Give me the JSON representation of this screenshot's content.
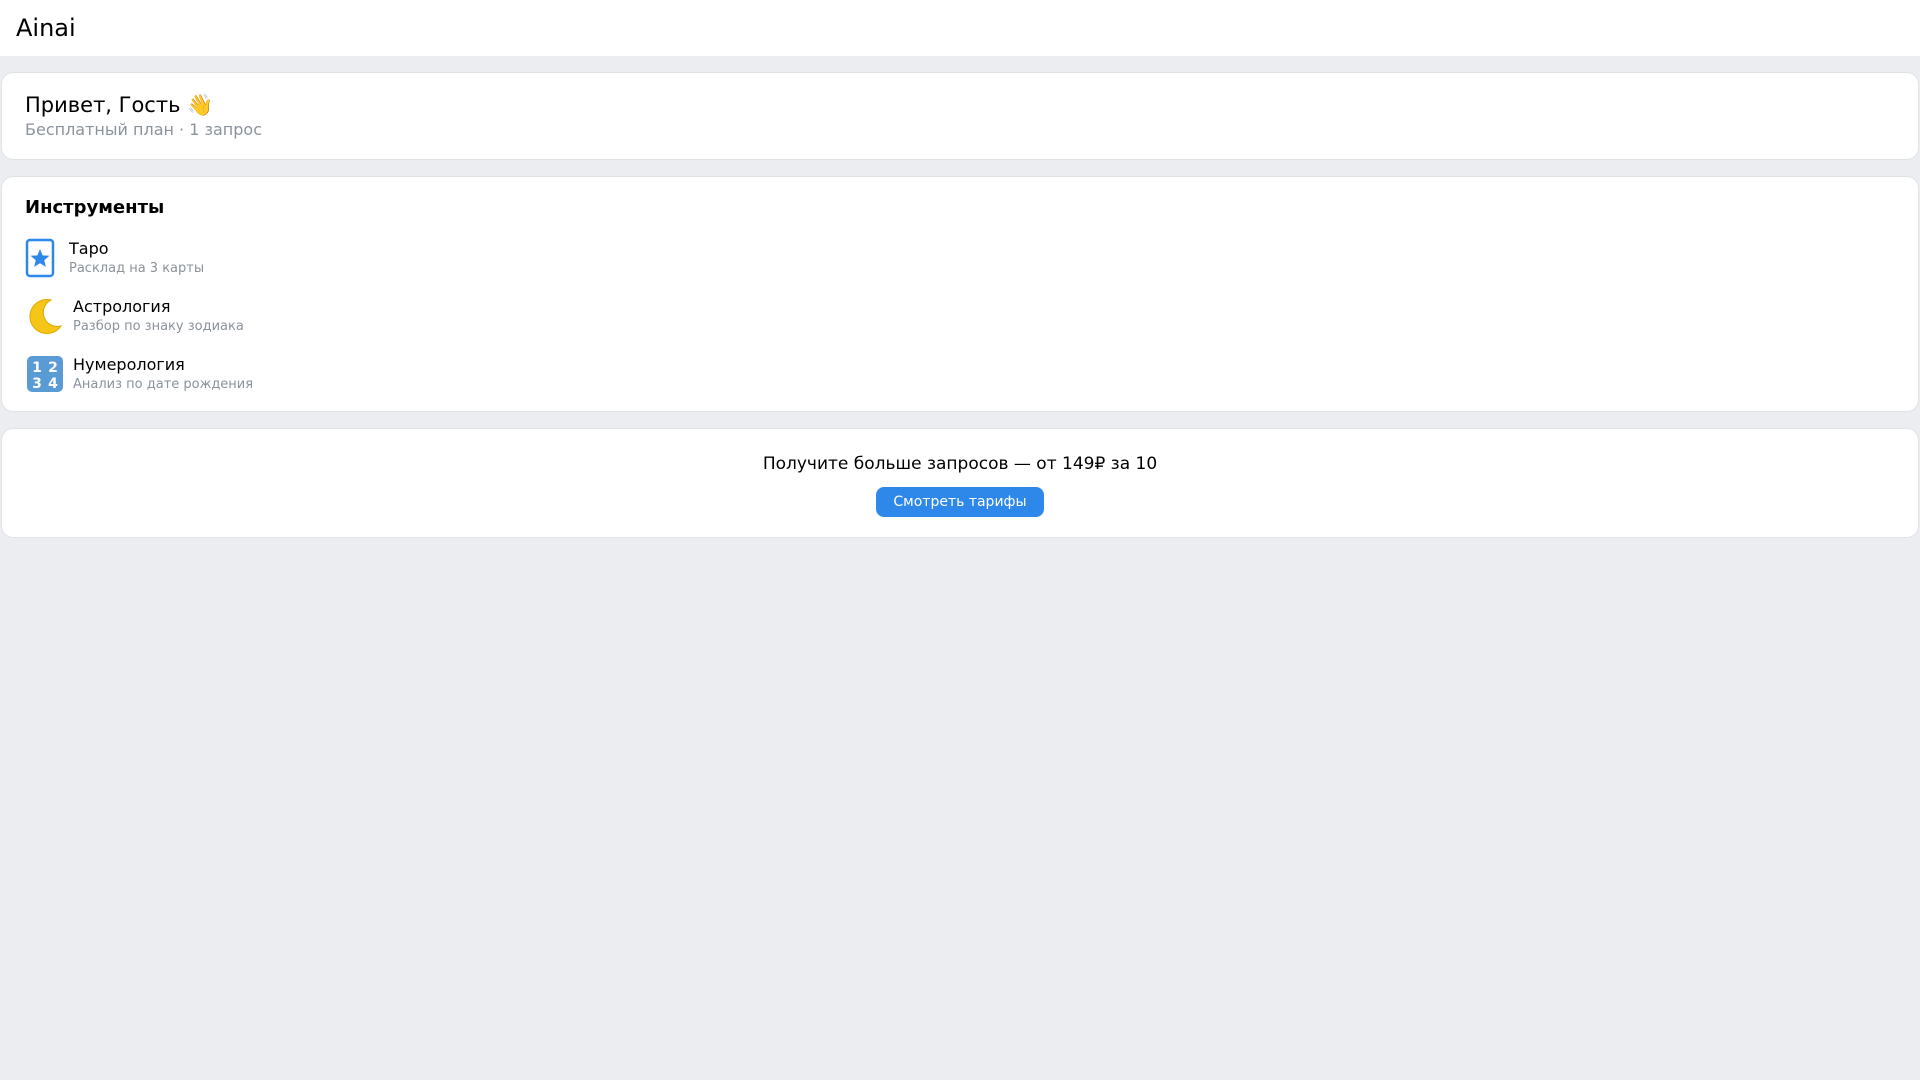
{
  "header": {
    "title": "Ainai"
  },
  "greeting": {
    "title": "Привет, Гость 👋",
    "subtitle": "Бесплатный план · 1 запрос"
  },
  "tools": {
    "heading": "Инструменты",
    "items": [
      {
        "icon": "tarot-card-icon",
        "name": "Таро",
        "description": "Расклад на 3 карты"
      },
      {
        "icon": "crescent-moon-icon",
        "name": "Астрология",
        "description": "Разбор по знаку зодиака"
      },
      {
        "icon": "numbers-1234-icon",
        "name": "Нумерология",
        "description": "Анализ по дате рождения"
      }
    ]
  },
  "promo": {
    "text": "Получите больше запросов — от 149₽ за 10",
    "button_label": "Смотреть тарифы"
  },
  "colors": {
    "accent": "#2d88ea",
    "background": "#ebedf0",
    "muted_text": "#8a929c"
  }
}
